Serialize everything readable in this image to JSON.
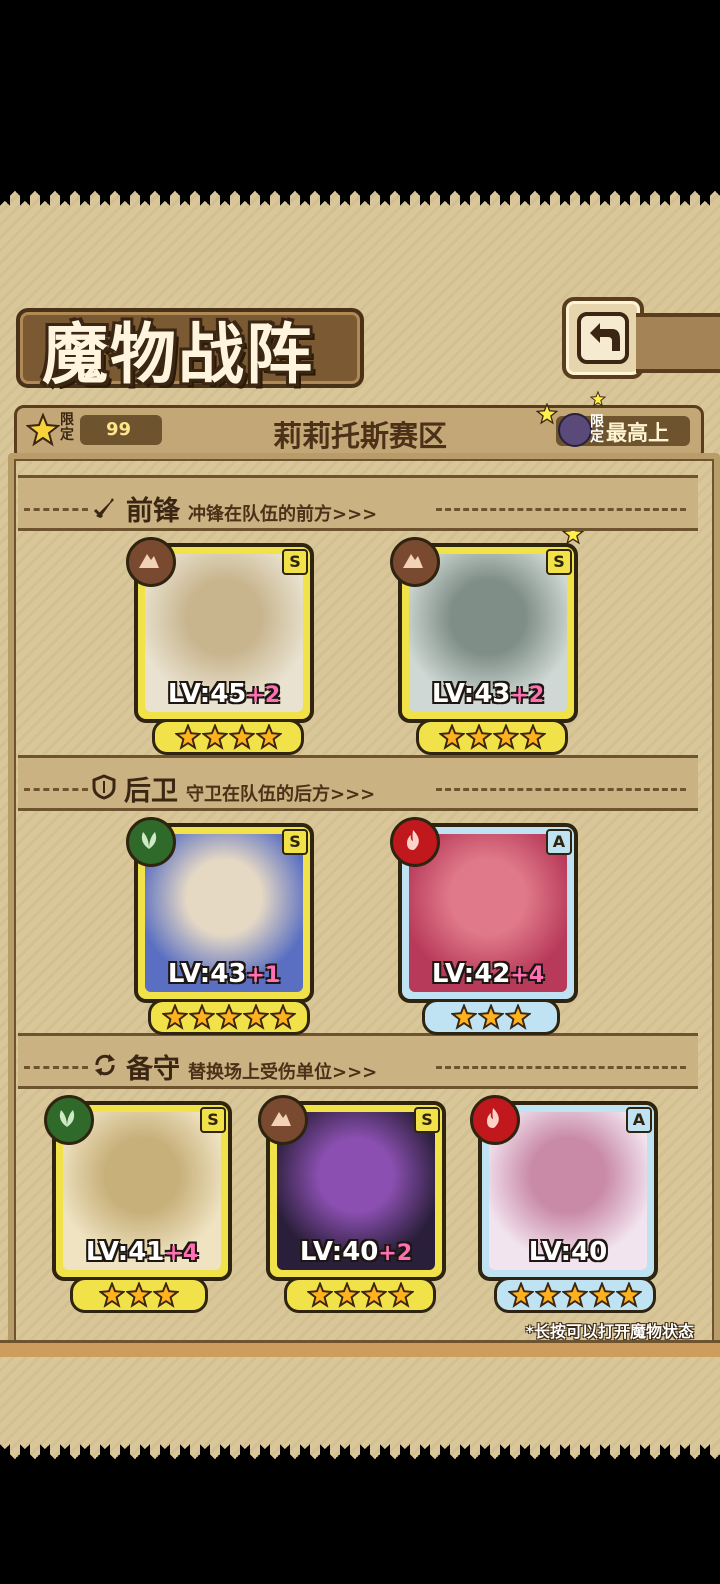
{
  "header": {
    "title": "魔物战阵",
    "back_icon": "back-arrow-icon"
  },
  "info_bar": {
    "limit_label": "限定",
    "limit_count": "99",
    "region": "莉莉托斯赛区",
    "right_limit_label": "限定",
    "right_text": "最高上",
    "accent": "#f7d23a"
  },
  "sections": {
    "front": {
      "name": "前锋",
      "desc": "冲锋在队伍的前方>>>"
    },
    "back": {
      "name": "后卫",
      "desc": "守卫在队伍的后方>>>"
    },
    "reserve": {
      "name": "备守",
      "desc": "替换场上受伤单位>>>"
    }
  },
  "cards": [
    {
      "lv": "LV:45",
      "plus": "+2",
      "rank": "S",
      "element": "earth",
      "stars": 4
    },
    {
      "lv": "LV:43",
      "plus": "+2",
      "rank": "S",
      "element": "earth",
      "stars": 4
    },
    {
      "lv": "LV:43",
      "plus": "+1",
      "rank": "S",
      "element": "wood",
      "stars": 5
    },
    {
      "lv": "LV:42",
      "plus": "+4",
      "rank": "A",
      "element": "fire",
      "stars": 3
    },
    {
      "lv": "LV:41",
      "plus": "+4",
      "rank": "S",
      "element": "wood",
      "stars": 3
    },
    {
      "lv": "LV:40",
      "plus": "+2",
      "rank": "S",
      "element": "earth",
      "stars": 4
    },
    {
      "lv": "LV:40",
      "plus": "",
      "rank": "A",
      "element": "fire",
      "stars": 5
    }
  ],
  "footnote": "*长按可以打开魔物状态"
}
